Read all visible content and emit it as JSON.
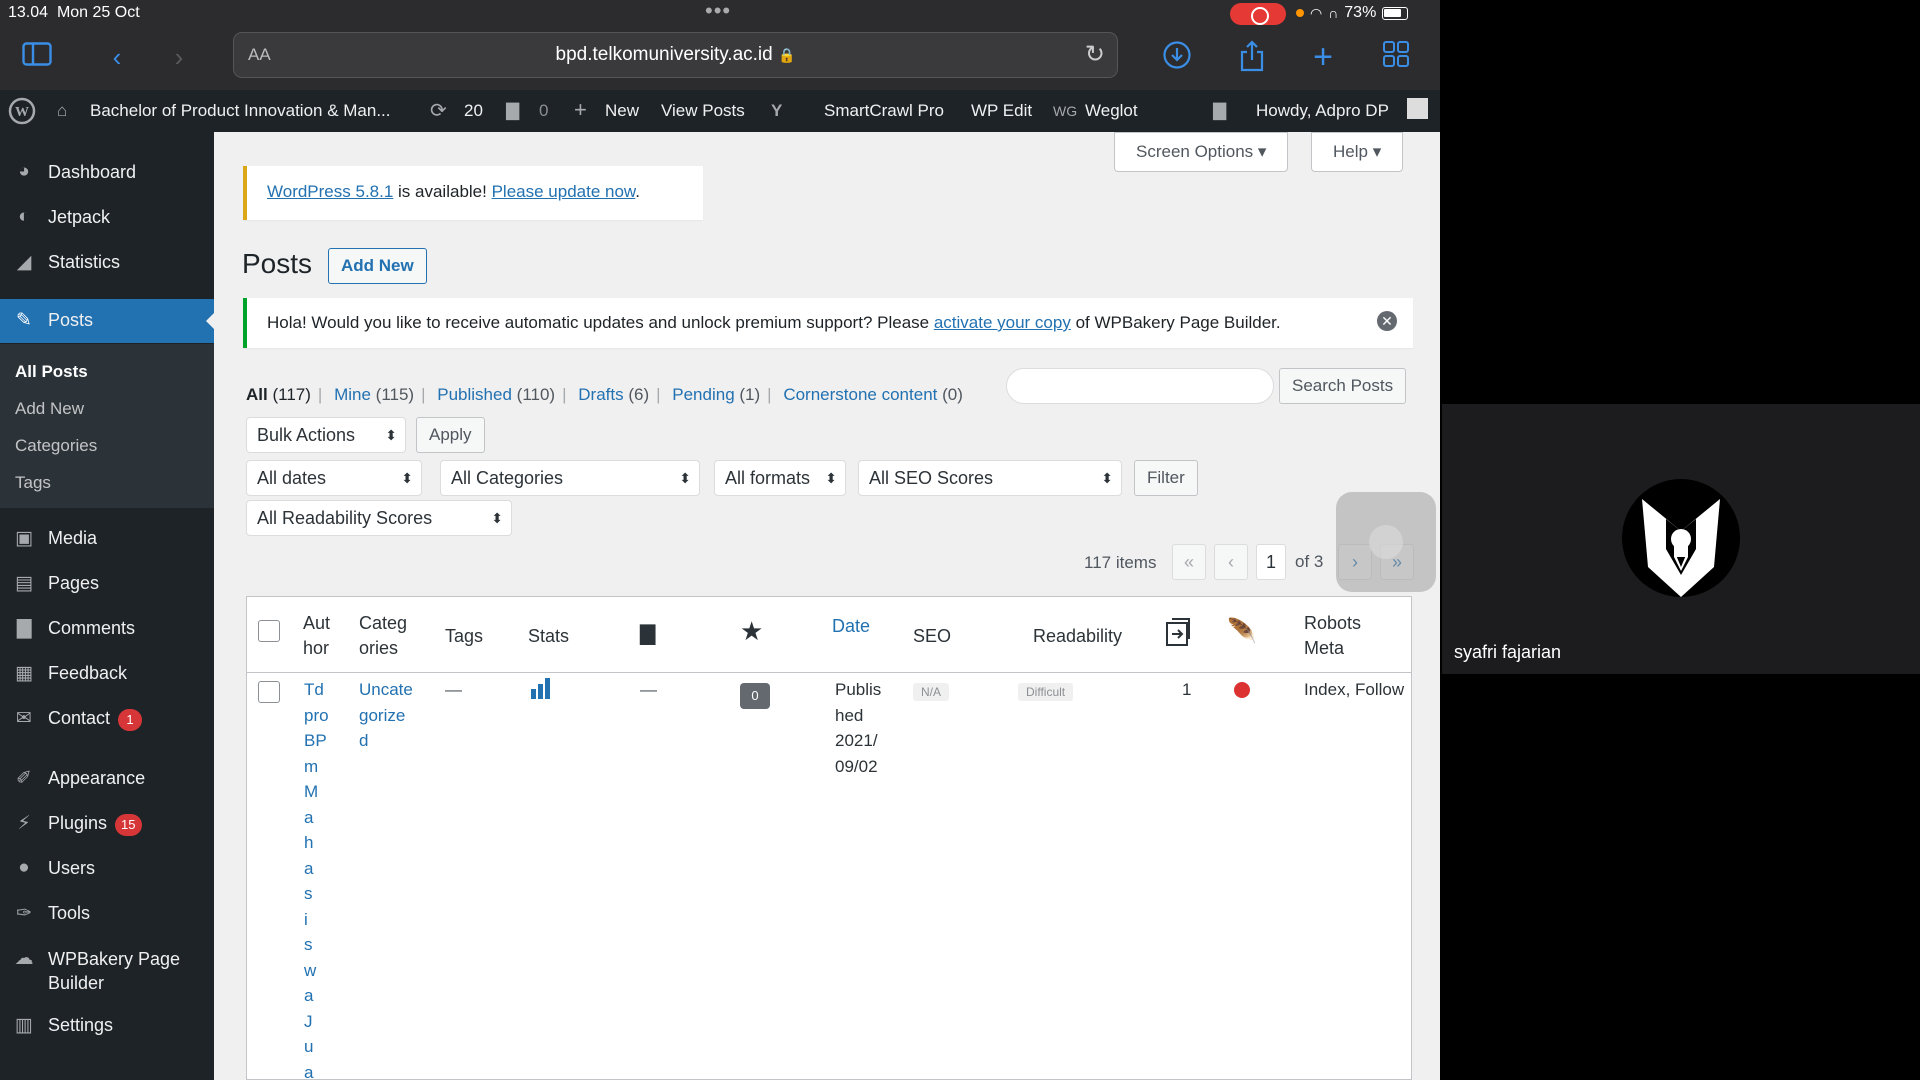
{
  "status": {
    "time": "13.04",
    "date": "Mon 25 Oct",
    "battery": "73%"
  },
  "browser": {
    "aa": "AA",
    "url": "bpd.telkomuniversity.ac.id"
  },
  "adminbar": {
    "site_name": "Bachelor of Product Innovation & Man...",
    "updates": "20",
    "comments": "0",
    "new": "New",
    "view_posts": "View Posts",
    "smartcrawl": "SmartCrawl Pro",
    "wp_edit": "WP Edit",
    "weglot": "Weglot",
    "howdy": "Howdy, Adpro DP"
  },
  "sidebar": {
    "items": [
      {
        "label": "Dashboard",
        "icon": "dashboard-icon"
      },
      {
        "label": "Jetpack",
        "icon": "jetpack-icon"
      },
      {
        "label": "Statistics",
        "icon": "statistics-icon"
      },
      {
        "label": "Posts",
        "icon": "pin-icon"
      },
      {
        "label": "Media",
        "icon": "media-icon"
      },
      {
        "label": "Pages",
        "icon": "pages-icon"
      },
      {
        "label": "Comments",
        "icon": "comments-icon"
      },
      {
        "label": "Feedback",
        "icon": "feedback-icon"
      },
      {
        "label": "Contact",
        "icon": "mail-icon",
        "badge": "1"
      },
      {
        "label": "Appearance",
        "icon": "brush-icon"
      },
      {
        "label": "Plugins",
        "icon": "plugin-icon",
        "badge": "15"
      },
      {
        "label": "Users",
        "icon": "users-icon"
      },
      {
        "label": "Tools",
        "icon": "tools-icon"
      },
      {
        "label": "WPBakery Page Builder",
        "icon": "wpbakery-icon"
      },
      {
        "label": "Settings",
        "icon": "settings-icon"
      }
    ],
    "submenu": [
      "All Posts",
      "Add New",
      "Categories",
      "Tags"
    ]
  },
  "top_buttons": {
    "screen_options": "Screen Options",
    "help": "Help"
  },
  "update_notice": {
    "link1": "WordPress 5.8.1",
    "mid": " is available! ",
    "link2": "Please update now",
    "end": "."
  },
  "page": {
    "title": "Posts",
    "add_new": "Add New"
  },
  "wpbakery_notice": {
    "pre": "Hola! Would you like to receive automatic updates and unlock premium support? Please ",
    "link": "activate your copy",
    "post": " of WPBakery Page Builder."
  },
  "filters": {
    "all": "All",
    "all_count": "(117)",
    "mine": "Mine",
    "mine_count": "(115)",
    "published": "Published",
    "published_count": "(110)",
    "drafts": "Drafts",
    "drafts_count": "(6)",
    "pending": "Pending",
    "pending_count": "(1)",
    "cornerstone": "Cornerstone content",
    "cornerstone_count": "(0)"
  },
  "search": {
    "button": "Search Posts",
    "value": ""
  },
  "bulk": {
    "select": "Bulk Actions",
    "apply": "Apply"
  },
  "dropdowns": {
    "dates": "All dates",
    "categories": "All Categories",
    "formats": "All formats",
    "seo": "All SEO Scores",
    "filter": "Filter",
    "readability": "All Readability Scores"
  },
  "pagination": {
    "items": "117 items",
    "first": "«",
    "prev": "‹",
    "current": "1",
    "of": "of 3",
    "next": "›",
    "last": "»"
  },
  "columns": {
    "author": "Aut\nhor",
    "categories": "Categ\nories",
    "tags": "Tags",
    "stats": "Stats",
    "date": "Date",
    "seo": "SEO",
    "readability": "Readability",
    "robots": "Robots\nMeta"
  },
  "row": {
    "title": "Td\npro\nBP\nm\nM\na\nh\na\ns\ni\ns\nw\na\nJ\nu\na",
    "category": "Uncate\ngorize\nd",
    "tags": "—",
    "comments": "—",
    "score": "0",
    "date": "Publis\nhed\n2021/\n09/02",
    "seo": "N/A",
    "readability": "Difficult",
    "links": "1",
    "robots": "Index, Follow"
  },
  "video": {
    "name": "syafri fajarian"
  }
}
